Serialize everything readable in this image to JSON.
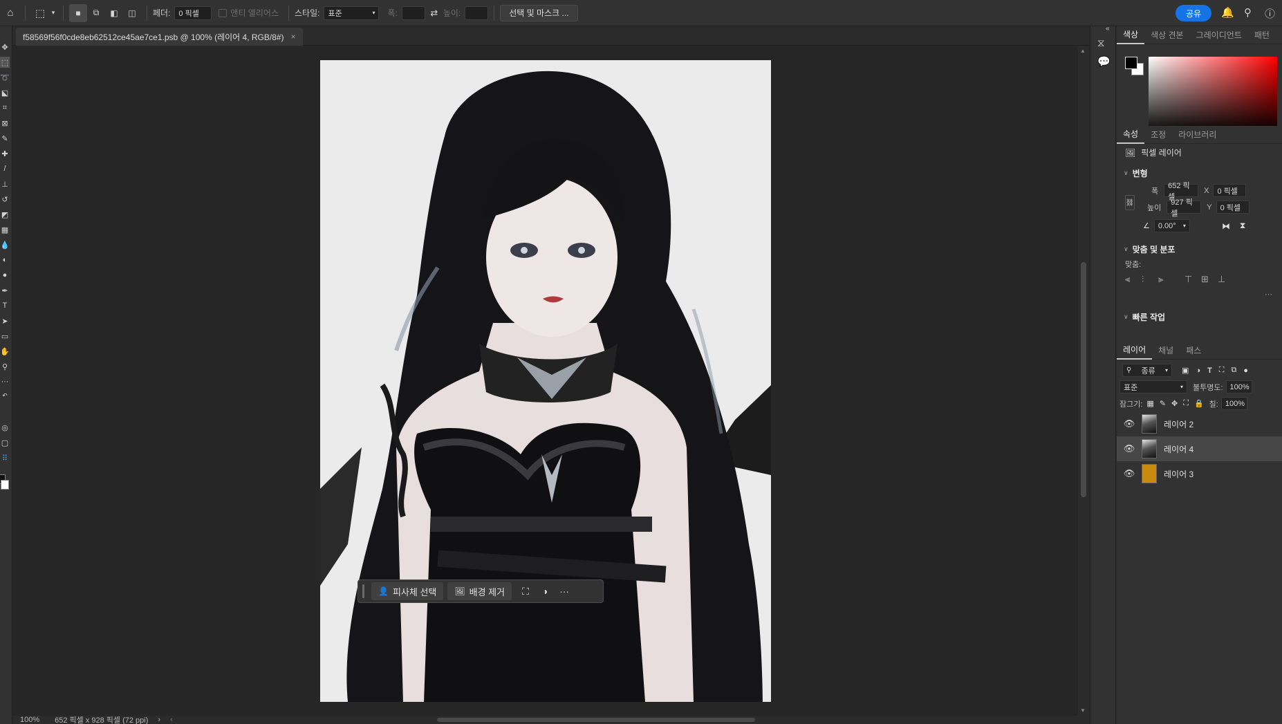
{
  "options_bar": {
    "feather_label": "페더:",
    "feather_value": "0 픽셀",
    "antialias_label": "앤티 앨리어스",
    "style_label": "스타일:",
    "style_value": "표준",
    "width_label": "폭:",
    "height_label": "높이:",
    "select_mask_button": "선택 및 마스크 ...",
    "share_button": "공유"
  },
  "document": {
    "tab_title": "f58569f56f0cde8eb62512ce45ae7ce1.psb @ 100% (레이어 4, RGB/8#)",
    "close": "×"
  },
  "taskbar": {
    "select_subject": "피사체 선택",
    "remove_background": "배경 제거",
    "more": "···"
  },
  "status": {
    "zoom": "100%",
    "doc_info": "652 픽셀 x 928 픽셀 (72 ppi)"
  },
  "color_panel": {
    "tabs": [
      "색상",
      "색상 견본",
      "그레이디언트",
      "패턴"
    ],
    "fg_color": "#000000",
    "bg_color": "#ffffff"
  },
  "properties_panel": {
    "tabs": [
      "속성",
      "조정",
      "라이브러리"
    ],
    "layer_type": "픽셀 레이어",
    "transform_title": "변형",
    "width_label": "폭",
    "width_value": "652 픽셀",
    "height_label": "높이",
    "height_value": "927 픽셀",
    "x_label": "X",
    "x_value": "0 픽셀",
    "y_label": "Y",
    "y_value": "0 픽셀",
    "angle_value": "0.00°",
    "align_title": "맞춤 및 분포",
    "align_label": "맞춤:",
    "quick_actions_title": "빠른 작업",
    "more": "···"
  },
  "layers_panel": {
    "tabs": [
      "레이어",
      "채널",
      "패스"
    ],
    "filter_value": "종류",
    "blend_mode": "표준",
    "opacity_label": "불투명도:",
    "opacity_value": "100%",
    "lock_label": "잠그기:",
    "fill_label": "칠:",
    "fill_value": "100%",
    "layers": [
      {
        "name": "레이어 2",
        "selected": false,
        "thumb": "image"
      },
      {
        "name": "레이어 4",
        "selected": true,
        "thumb": "image"
      },
      {
        "name": "레이어 3",
        "selected": false,
        "thumb": "#c98a10"
      }
    ]
  }
}
